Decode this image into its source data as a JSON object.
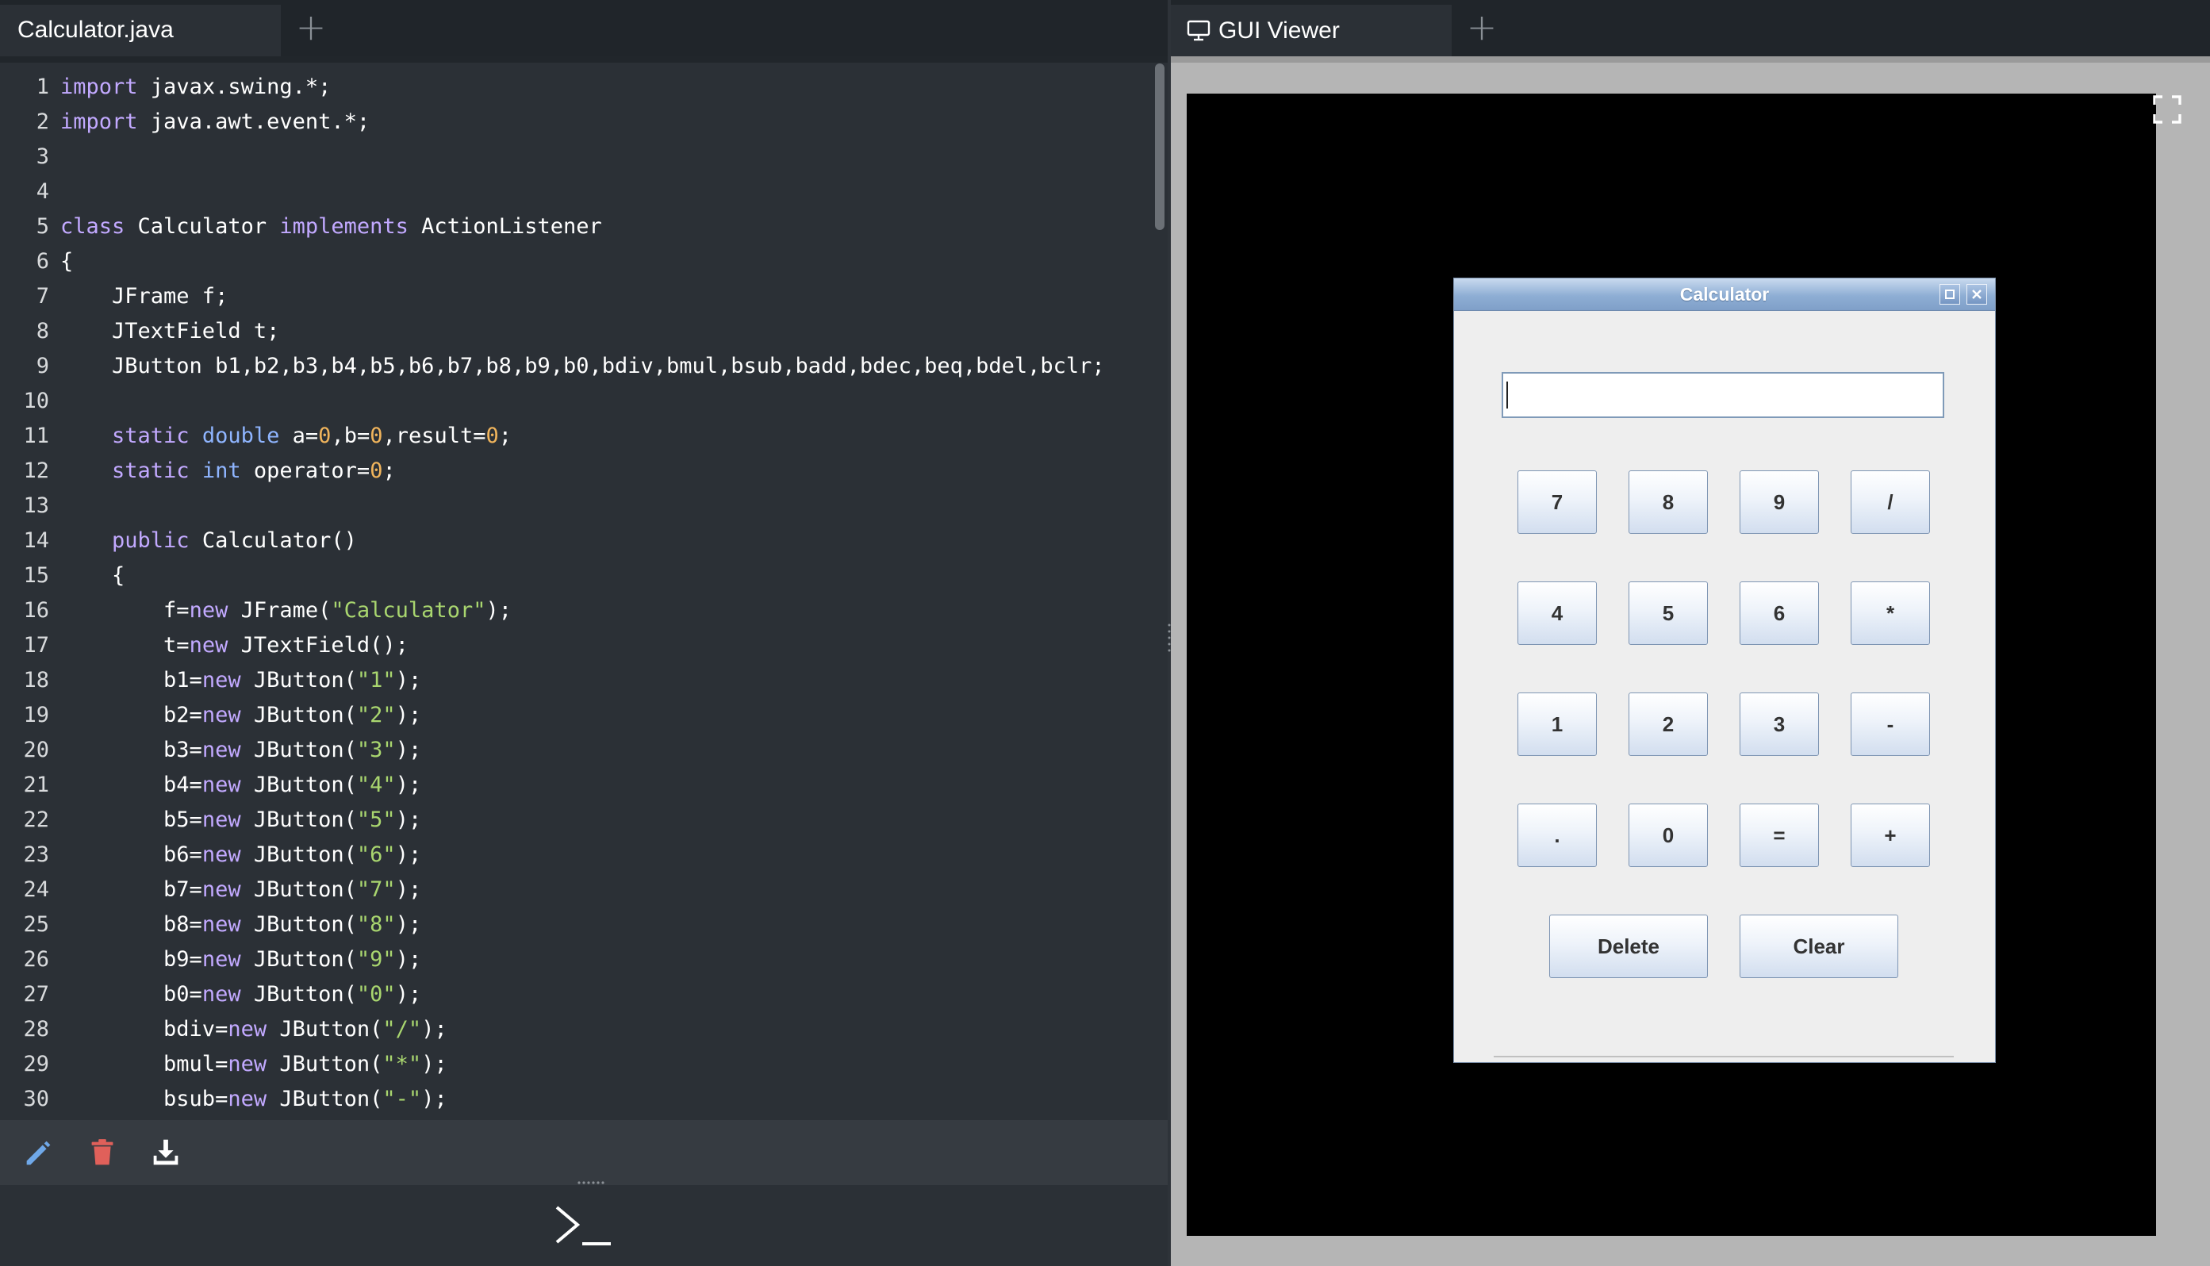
{
  "editor": {
    "tab_title": "Calculator.java",
    "add_tab_symbol": "+",
    "lines": [
      {
        "n": "1",
        "html": "<span class=\"kw\">import</span> javax.swing.*;"
      },
      {
        "n": "2",
        "html": "<span class=\"kw\">import</span> java.awt.event.*;"
      },
      {
        "n": "3",
        "html": ""
      },
      {
        "n": "4",
        "html": ""
      },
      {
        "n": "5",
        "html": "<span class=\"kw\">class</span> Calculator <span class=\"kw\">implements</span> ActionListener"
      },
      {
        "n": "6",
        "html": "{"
      },
      {
        "n": "7",
        "html": "    JFrame f;"
      },
      {
        "n": "8",
        "html": "    JTextField t;"
      },
      {
        "n": "9",
        "html": "    JButton b1,b2,b3,b4,b5,b6,b7,b8,b9,b0,bdiv,bmul,bsub,badd,bdec,beq,bdel,bclr;"
      },
      {
        "n": "10",
        "html": ""
      },
      {
        "n": "11",
        "html": "    <span class=\"kw\">static</span> <span class=\"kt\">double</span> a=<span class=\"num\">0</span>,b=<span class=\"num\">0</span>,result=<span class=\"num\">0</span>;"
      },
      {
        "n": "12",
        "html": "    <span class=\"kw\">static</span> <span class=\"kt\">int</span> operator=<span class=\"num\">0</span>;"
      },
      {
        "n": "13",
        "html": ""
      },
      {
        "n": "14",
        "html": "    <span class=\"kw\">public</span> Calculator()"
      },
      {
        "n": "15",
        "html": "    {"
      },
      {
        "n": "16",
        "html": "        f=<span class=\"kw\">new</span> JFrame(<span class=\"str\">\"Calculator\"</span>);"
      },
      {
        "n": "17",
        "html": "        t=<span class=\"kw\">new</span> JTextField();"
      },
      {
        "n": "18",
        "html": "        b1=<span class=\"kw\">new</span> JButton(<span class=\"str\">\"1\"</span>);"
      },
      {
        "n": "19",
        "html": "        b2=<span class=\"kw\">new</span> JButton(<span class=\"str\">\"2\"</span>);"
      },
      {
        "n": "20",
        "html": "        b3=<span class=\"kw\">new</span> JButton(<span class=\"str\">\"3\"</span>);"
      },
      {
        "n": "21",
        "html": "        b4=<span class=\"kw\">new</span> JButton(<span class=\"str\">\"4\"</span>);"
      },
      {
        "n": "22",
        "html": "        b5=<span class=\"kw\">new</span> JButton(<span class=\"str\">\"5\"</span>);"
      },
      {
        "n": "23",
        "html": "        b6=<span class=\"kw\">new</span> JButton(<span class=\"str\">\"6\"</span>);"
      },
      {
        "n": "24",
        "html": "        b7=<span class=\"kw\">new</span> JButton(<span class=\"str\">\"7\"</span>);"
      },
      {
        "n": "25",
        "html": "        b8=<span class=\"kw\">new</span> JButton(<span class=\"str\">\"8\"</span>);"
      },
      {
        "n": "26",
        "html": "        b9=<span class=\"kw\">new</span> JButton(<span class=\"str\">\"9\"</span>);"
      },
      {
        "n": "27",
        "html": "        b0=<span class=\"kw\">new</span> JButton(<span class=\"str\">\"0\"</span>);"
      },
      {
        "n": "28",
        "html": "        bdiv=<span class=\"kw\">new</span> JButton(<span class=\"str\">\"/\"</span>);"
      },
      {
        "n": "29",
        "html": "        bmul=<span class=\"kw\">new</span> JButton(<span class=\"str\">\"*\"</span>);"
      },
      {
        "n": "30",
        "html": "        bsub=<span class=\"kw\">new</span> JButton(<span class=\"str\">\"-\"</span>);"
      }
    ]
  },
  "toolbar": {
    "edit_icon": "pencil-icon",
    "delete_icon": "trash-icon",
    "download_icon": "download-icon",
    "console_icon": "terminal-icon"
  },
  "viewer": {
    "tab_title": "GUI Viewer",
    "tab_icon": "monitor-icon",
    "add_tab_symbol": "+",
    "fullscreen_icon": "fullscreen-icon"
  },
  "calculator": {
    "title": "Calculator",
    "display_value": "",
    "keys": [
      {
        "label": "7",
        "name": "key-7-button"
      },
      {
        "label": "8",
        "name": "key-8-button"
      },
      {
        "label": "9",
        "name": "key-9-button"
      },
      {
        "label": "/",
        "name": "key-divide-button"
      },
      {
        "label": "4",
        "name": "key-4-button"
      },
      {
        "label": "5",
        "name": "key-5-button"
      },
      {
        "label": "6",
        "name": "key-6-button"
      },
      {
        "label": "*",
        "name": "key-multiply-button"
      },
      {
        "label": "1",
        "name": "key-1-button"
      },
      {
        "label": "2",
        "name": "key-2-button"
      },
      {
        "label": "3",
        "name": "key-3-button"
      },
      {
        "label": "-",
        "name": "key-subtract-button"
      },
      {
        "label": ".",
        "name": "key-decimal-button"
      },
      {
        "label": "0",
        "name": "key-0-button"
      },
      {
        "label": "=",
        "name": "key-equals-button"
      },
      {
        "label": "+",
        "name": "key-add-button"
      }
    ],
    "delete_label": "Delete",
    "clear_label": "Clear"
  },
  "colors": {
    "editor_bg": "#2b3036",
    "keyword": "#c2a9ff",
    "type": "#8fb5ff",
    "number": "#f0b45c",
    "string": "#a9d66f",
    "trash": "#e0605a",
    "pencil": "#6fa8e8"
  }
}
